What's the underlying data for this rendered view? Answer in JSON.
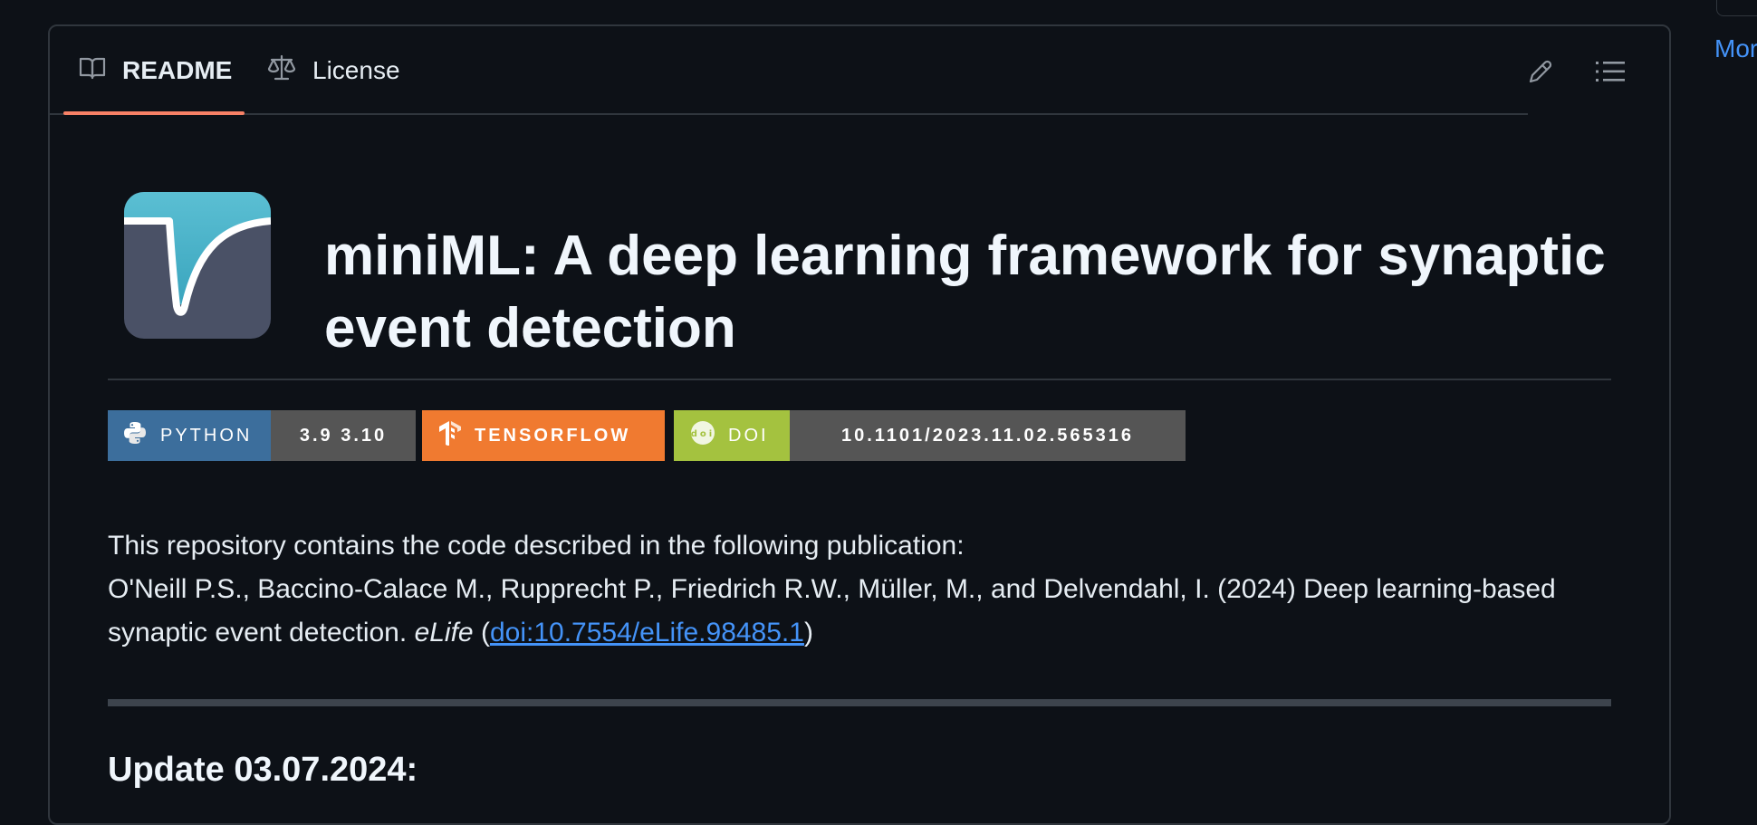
{
  "sidebar_right": {
    "more_label": "Mor"
  },
  "tabs": [
    {
      "label": "README",
      "icon": "book-icon",
      "selected": true
    },
    {
      "label": "License",
      "icon": "scale-icon",
      "selected": false
    }
  ],
  "toolbar": {
    "edit_icon": "pencil-icon",
    "outline_icon": "list-icon"
  },
  "readme": {
    "logo_icon": "miniml-logo",
    "title": "miniML: A deep learning framework for synaptic event detection",
    "badges": {
      "python": {
        "label": "PYTHON",
        "value": "3.9 3.10",
        "color": "#3c6e9c"
      },
      "tensorflow": {
        "label": "TENSORFLOW",
        "color": "#f07a30"
      },
      "doi": {
        "label": "DOI",
        "value": "10.1101/2023.11.02.565316",
        "color": "#a4c23f"
      }
    },
    "intro_line": "This repository contains the code described in the following publication:",
    "citation_text": "O'Neill P.S., Baccino-Calace M., Rupprecht P., Friedrich R.W., Müller, M., and Delvendahl, I. (2024) Deep learning-based synaptic event detection.",
    "journal": "eLife",
    "open_paren": "(",
    "doi_link": "doi:10.7554/eLife.98485.1",
    "close_paren": ")",
    "update_heading": "Update 03.07.2024:"
  },
  "colors": {
    "accent_underline": "#f78166",
    "link": "#4493f8",
    "background": "#0d1117"
  }
}
